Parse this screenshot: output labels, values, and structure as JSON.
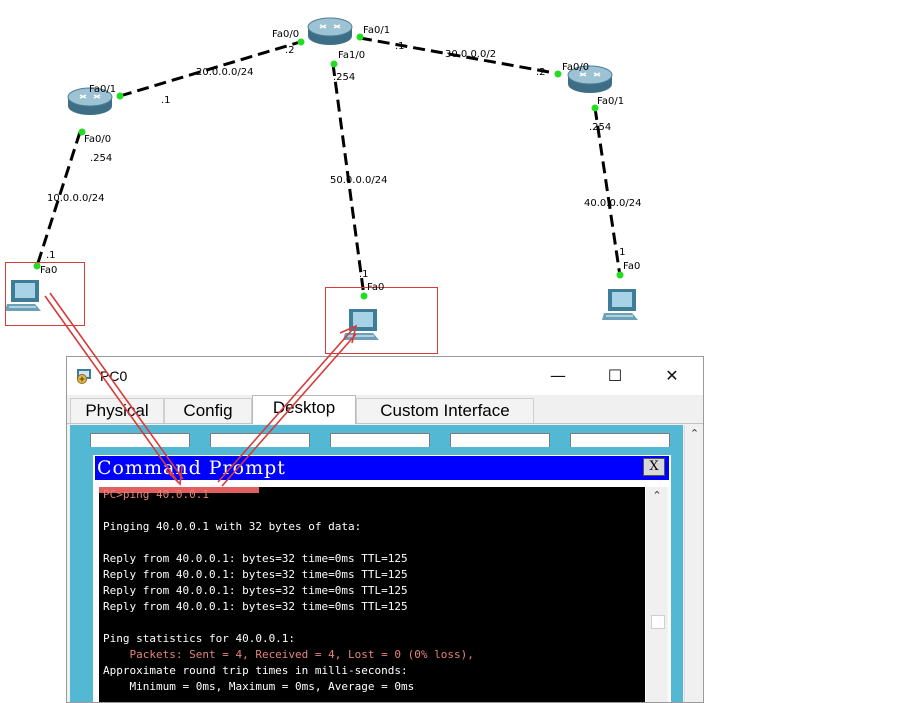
{
  "topology": {
    "interfaces": {
      "left_router_fa01": "Fa0/1",
      "left_router_fa00": "Fa0/0",
      "center_router_fa00": "Fa0/0",
      "center_router_fa01": "Fa0/1",
      "center_router_fa10": "Fa1/0",
      "right_router_fa00": "Fa0/0",
      "right_router_fa01": "Fa0/1",
      "pc0_fa0": "Fa0",
      "pc1_fa0": "Fa0",
      "pc2_fa0": "Fa0"
    },
    "addresses": {
      "left_router_dot1": ".1",
      "left_router_dot254": ".254",
      "center_router_dot2": ".2",
      "center_router_dot1": ".1",
      "center_router_dot254": ".254",
      "right_router_dot2": ".2",
      "right_router_dot254": ".254",
      "pc0_dot1": ".1",
      "pc1_dot1": ".1",
      "pc2_dot1": ".1"
    },
    "networks": {
      "net10": "10.0.0.0/24",
      "net20": "20.0.0.0/24",
      "net30": "30.0.0.0/2",
      "net40": "40.0.0.0/24",
      "net50": "50.0.0.0/24"
    },
    "link_color": "#000000",
    "port_color": "#22dd22",
    "highlight_color": "#d93a3a"
  },
  "window": {
    "title": "PC0",
    "minimize_glyph": "—",
    "maximize_glyph": "☐",
    "close_glyph": "✕",
    "tabs": [
      "Physical",
      "Config",
      "Desktop",
      "Custom Interface"
    ],
    "active_tab": "Desktop",
    "scroll_up_glyph": "⌃"
  },
  "command_prompt": {
    "title": "Command Prompt",
    "close_label": "X",
    "lines": [
      {
        "text": "PC>ping 40.0.0.1",
        "style": "dim"
      },
      {
        "text": "",
        "style": "normal"
      },
      {
        "text": "Pinging 40.0.0.1 with 32 bytes of data:",
        "style": "normal"
      },
      {
        "text": "",
        "style": "normal"
      },
      {
        "text": "Reply from 40.0.0.1: bytes=32 time=0ms TTL=125",
        "style": "normal"
      },
      {
        "text": "Reply from 40.0.0.1: bytes=32 time=0ms TTL=125",
        "style": "normal"
      },
      {
        "text": "Reply from 40.0.0.1: bytes=32 time=0ms TTL=125",
        "style": "normal"
      },
      {
        "text": "Reply from 40.0.0.1: bytes=32 time=0ms TTL=125",
        "style": "normal"
      },
      {
        "text": "",
        "style": "normal"
      },
      {
        "text": "Ping statistics for 40.0.0.1:",
        "style": "normal"
      },
      {
        "text": "    Packets: Sent = 4, Received = 4, Lost = 0 (0% loss),",
        "style": "dim"
      },
      {
        "text": "Approximate round trip times in milli-seconds:",
        "style": "normal"
      },
      {
        "text": "    Minimum = 0ms, Maximum = 0ms, Average = 0ms",
        "style": "normal"
      }
    ]
  },
  "colors": {
    "title_bar_blue": "#0000ff",
    "desktop_blue": "#53b8d4",
    "terminal_bg": "#000000",
    "terminal_text": "#ffffff",
    "terminal_dim_text": "#e2847d"
  }
}
